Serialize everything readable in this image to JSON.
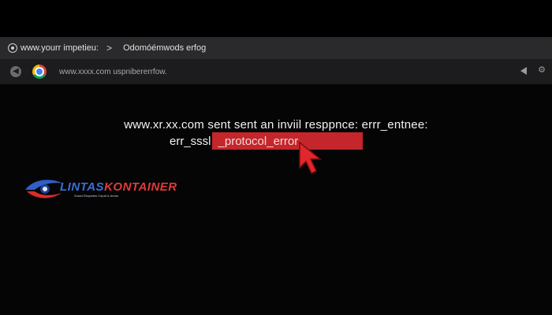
{
  "tab_bar": {
    "tab1_title": "www.yourr impetieu:",
    "separator": ">",
    "tab2_title": "Odomóémwods erfog"
  },
  "address_bar": {
    "url": "www.xxxx.com uspnibererrfow."
  },
  "error": {
    "line1": "www.xr.xx.com sent sent an inviil resppnce: errr_entnee:",
    "line2_prefix": "err_sssl",
    "line2_highlight": "_protocol_error",
    "highlight_color": "#c4262b"
  },
  "watermark": {
    "brand_part1": "LINTAS",
    "brand_part2": "KONTAINER",
    "tagline": "Solusi Ekspedisi Cepat & Aman",
    "brand_colors": [
      "#3a6fd8",
      "#e23a3a"
    ]
  },
  "icons": [
    "tab-site-icon",
    "back-icon",
    "chrome-logo-icon",
    "cast-icon",
    "settings-icon",
    "cursor-arrow-icon",
    "eye-logo-icon"
  ]
}
